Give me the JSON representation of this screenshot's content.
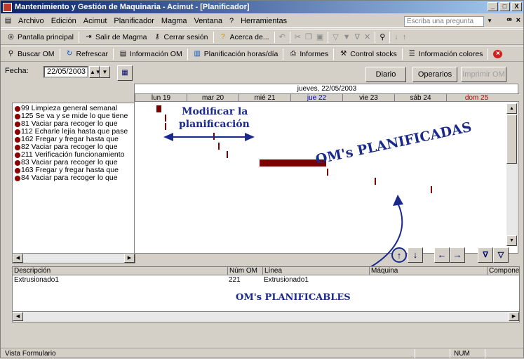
{
  "window": {
    "title": "Mantenimiento y Gestión de Maquinaria - Acimut - [Planificador]",
    "controls": [
      "_",
      "□",
      "X"
    ]
  },
  "menu": {
    "items": [
      "Archivo",
      "Edición",
      "Acimut",
      "Planificador",
      "Magma",
      "Ventana",
      "?",
      "Herramientas"
    ],
    "ask_placeholder": "Escriba una pregunta",
    "mdi_controls": [
      "▾",
      "ꟹ",
      "×"
    ]
  },
  "toolbar1": {
    "pantalla": "Pantalla principal",
    "salir": "Salir de Magma",
    "cerrar": "Cerrar sesión",
    "acerca": "Acerca de..."
  },
  "toolbar2": {
    "buscar": "Buscar OM",
    "refrescar": "Refrescar",
    "info_om": "Información OM",
    "planif": "Planificación horas/día",
    "informes": "Informes",
    "stocks": "Control stocks",
    "info_colores": "Información colores"
  },
  "planner": {
    "fecha_label": "Fecha:",
    "fecha_value": "22/05/2003",
    "btn_diario": "Diario",
    "btn_operarios": "Operarios",
    "btn_imprimir": "Imprimir OM",
    "header_date": "jueves, 22/05/2003",
    "days": [
      "lun 19",
      "mar 20",
      "mié 21",
      "jue 22",
      "vie 23",
      "sáb 24",
      "dom 25"
    ],
    "orders": [
      "99 Limpieza general semanal",
      "125 Se va y se mide lo que tiene",
      "81 Vaciar para recoger lo que",
      "112 Echarle lejía hasta que pase",
      "162 Fregar y fregar hasta que",
      "82 Vaciar para recoger lo que",
      "211 Verificación funcionamiento",
      "83 Vaciar para recoger lo que",
      "163 Fregar y fregar hasta que",
      "84 Vaciar para recoger lo que"
    ],
    "annotation_modify_1": "Modificar la",
    "annotation_modify_2": "planificación",
    "annotation_planned": "OM's PLANIFICADAS",
    "annotation_plannable": "OM's PLANIFICABLES"
  },
  "grid": {
    "headers": [
      "Descripción",
      "Núm OM",
      "Línea",
      "Máquina",
      "Compone"
    ],
    "row": [
      "Extrusionado1",
      "221",
      "Extrusionado1",
      "",
      ""
    ]
  },
  "status": {
    "left": "Vista Formulario",
    "num": "NUM"
  }
}
